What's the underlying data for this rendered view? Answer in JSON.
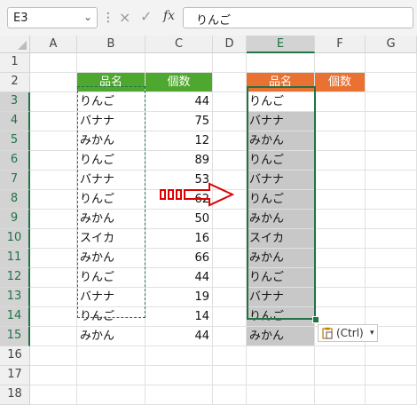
{
  "formula_bar": {
    "name_box": "E3",
    "name_box_dropdown_icon": "chevron-down-icon",
    "cancel_icon": "×",
    "enter_icon": "✓",
    "fx_label": "fx",
    "formula_value": "りんご"
  },
  "column_headers": [
    "A",
    "B",
    "C",
    "D",
    "E",
    "F",
    "G"
  ],
  "row_headers": [
    "1",
    "2",
    "3",
    "4",
    "5",
    "6",
    "7",
    "8",
    "9",
    "10",
    "11",
    "12",
    "13",
    "14",
    "15",
    "16",
    "17",
    "18"
  ],
  "selected_column": "E",
  "header_colors": {
    "green": "#4ea72e",
    "orange": "#e97132",
    "selection_border": "#217346",
    "arrow": "#e00000"
  },
  "table_left": {
    "headers": [
      "品名",
      "個数"
    ],
    "rows": [
      [
        "りんご",
        "44"
      ],
      [
        "バナナ",
        "75"
      ],
      [
        "みかん",
        "12"
      ],
      [
        "りんご",
        "89"
      ],
      [
        "バナナ",
        "53"
      ],
      [
        "りんご",
        "62"
      ],
      [
        "みかん",
        "50"
      ],
      [
        "スイカ",
        "16"
      ],
      [
        "みかん",
        "66"
      ],
      [
        "りんご",
        "44"
      ],
      [
        "バナナ",
        "19"
      ],
      [
        "りんご",
        "14"
      ],
      [
        "みかん",
        "44"
      ]
    ]
  },
  "table_right": {
    "headers": [
      "品名",
      "個数"
    ],
    "values": [
      "りんご",
      "バナナ",
      "みかん",
      "りんご",
      "バナナ",
      "りんご",
      "みかん",
      "スイカ",
      "みかん",
      "りんご",
      "バナナ",
      "りんご",
      "みかん"
    ]
  },
  "paste_options": {
    "label": "(Ctrl)",
    "icon": "clipboard-icon",
    "dropdown": "▾"
  }
}
